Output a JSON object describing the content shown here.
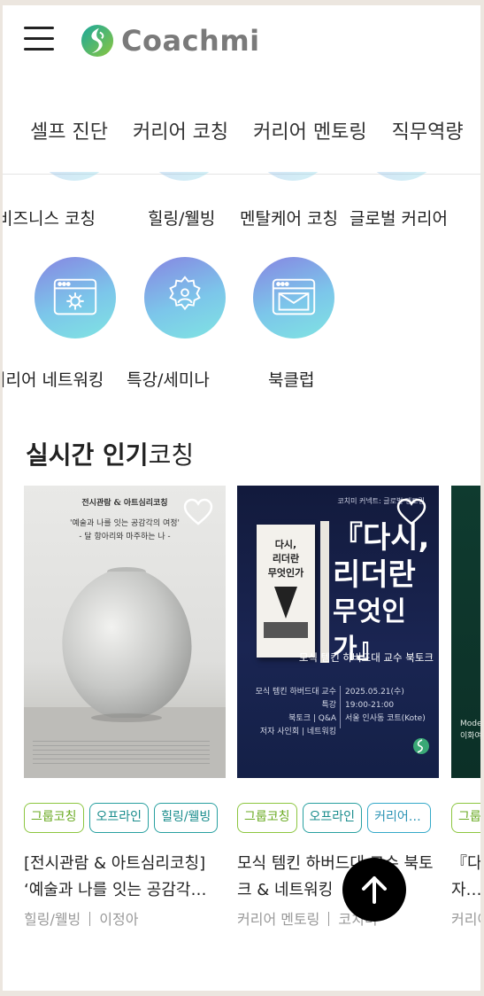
{
  "header": {
    "logo_text": "Coachmi"
  },
  "tabs": [
    "셀프 진단",
    "커리어 코칭",
    "커리어 멘토링",
    "직무역량"
  ],
  "categories_row1": [
    "비즈니스 코칭",
    "힐링/웰빙",
    "멘탈케어 코칭",
    "글로벌 커리어"
  ],
  "categories_row2": [
    {
      "label": "커리어 네트워킹",
      "icon": "browser-gear-icon"
    },
    {
      "label": "특강/세미나",
      "icon": "person-gear-icon"
    },
    {
      "label": "북클럽",
      "icon": "browser-mail-icon"
    }
  ],
  "section": {
    "title_bold": "실시간 인기",
    "title_light": "코칭"
  },
  "cards": [
    {
      "poster_lines": [
        "전시관람 & 아트심리코칭",
        "'예술과 나를 잇는 공감각의 여정'",
        "- 달 항아리와 마주하는 나 -"
      ],
      "tags": [
        "그룹코칭",
        "오프라인",
        "힐링/웰빙"
      ],
      "title": "[전시관람 & 아트심리코칭] ‘예술과 나를 잇는 공감각…",
      "category": "힐링/웰빙",
      "author": "이정아"
    },
    {
      "poster_lines": [
        "코치미 커넥트: 글로벌 멘토링",
        "『다시,",
        "리더란",
        "무엇인가』",
        "모식 템킨 하버드대 교수 북토크",
        "모식 템킨 하버드대 교수 특강",
        "북토크 | Q&A",
        "저자 사인회 | 네트워킹",
        "2025.05.21(수)",
        "19:00-21:00",
        "서울 인사동 코트(Kote)"
      ],
      "tags": [
        "그룹코칭",
        "오프라인",
        "커리어 …"
      ],
      "title": "모식 템킨 하버드대 교수 북토크 & 네트워킹",
      "category": "커리어 멘토링",
      "author": "코치미"
    },
    {
      "poster_lines": [
        "Moderator",
        "이화여대"
      ],
      "tags": [
        "그룹코칭"
      ],
      "title": "『다시, 리더란 무엇인가』 저자…",
      "category": "커리어",
      "author": ""
    }
  ],
  "colors": {
    "green_tag": "#8cc63f",
    "teal_tag": "#28a0a0",
    "blue_tag": "#34a9c9",
    "icon_gradient_start": "#8785e2",
    "icon_gradient_end": "#80e4e2"
  }
}
